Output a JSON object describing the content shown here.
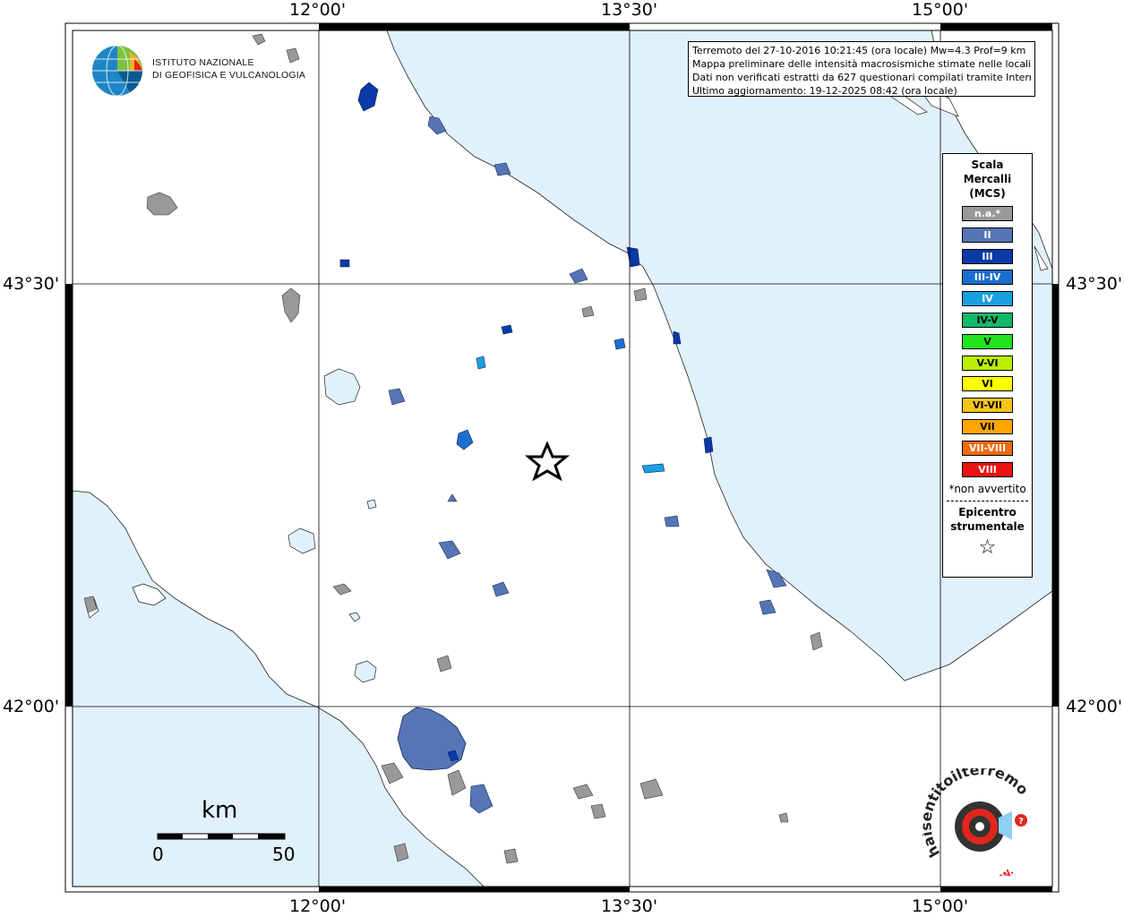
{
  "map": {
    "grid_labels": {
      "lon": [
        "12°00'",
        "13°30'",
        "15°00'"
      ],
      "lat": [
        "43°30'",
        "42°00'"
      ]
    },
    "colors": {
      "sea": "#e1f1fb",
      "land": "#ffffff",
      "intensity_na": "#999999",
      "intensity_II": "#5575b5",
      "intensity_III": "#0a3aa8",
      "intensity_III_IV": "#1a6fd0",
      "intensity_IV": "#19a0e0"
    }
  },
  "info": {
    "line1": "Terremoto del 27-10-2016 10:21:45 (ora locale) Mw=4.3 Prof=9 km",
    "line2": "Mappa preliminare delle intensità macrosismiche stimate nelle località",
    "line3": "Dati non verificati estratti da 627 questionari compilati tramite Internet.",
    "line4": "Ultimo aggiornamento: 19-12-2025 08:42 (ora locale)"
  },
  "legend": {
    "title": [
      "Scala",
      "Mercalli",
      "(MCS)"
    ],
    "items": [
      {
        "label": "n.a.*",
        "color": "#999999",
        "text_color": "#ffffff"
      },
      {
        "label": "II",
        "color": "#5575b5",
        "text_color": "#ffffff"
      },
      {
        "label": "III",
        "color": "#0a3aa8",
        "text_color": "#ffffff"
      },
      {
        "label": "III-IV",
        "color": "#1a6fd0",
        "text_color": "#ffffff"
      },
      {
        "label": "IV",
        "color": "#19a0e0",
        "text_color": "#ffffff"
      },
      {
        "label": "IV-V",
        "color": "#12b86a",
        "text_color": "#000000"
      },
      {
        "label": "V",
        "color": "#22e41b",
        "text_color": "#000000"
      },
      {
        "label": "V-VI",
        "color": "#b8f000",
        "text_color": "#000000"
      },
      {
        "label": "VI",
        "color": "#ffff00",
        "text_color": "#000000"
      },
      {
        "label": "VI-VII",
        "color": "#f5c518",
        "text_color": "#000000"
      },
      {
        "label": "VII",
        "color": "#ffa500",
        "text_color": "#000000"
      },
      {
        "label": "VII-VIII",
        "color": "#f06a10",
        "text_color": "#ffffff"
      },
      {
        "label": "VIII",
        "color": "#ee1111",
        "text_color": "#ffffff"
      }
    ],
    "note": "*non avvertito",
    "epicenter_title": [
      "Epicentro",
      "strumentale"
    ],
    "epicenter_symbol": "☆"
  },
  "institute": {
    "name_line1": "ISTITUTO NAZIONALE",
    "name_line2": "DI GEOFISICA E VULCANOLOGIA"
  },
  "scale_bar": {
    "unit": "km",
    "min": "0",
    "max": "50"
  },
  "hsi_logo": {
    "text": "haisentitoilterremoto.it",
    "url_text": "WWW.",
    "icon": "speaker-icon"
  }
}
